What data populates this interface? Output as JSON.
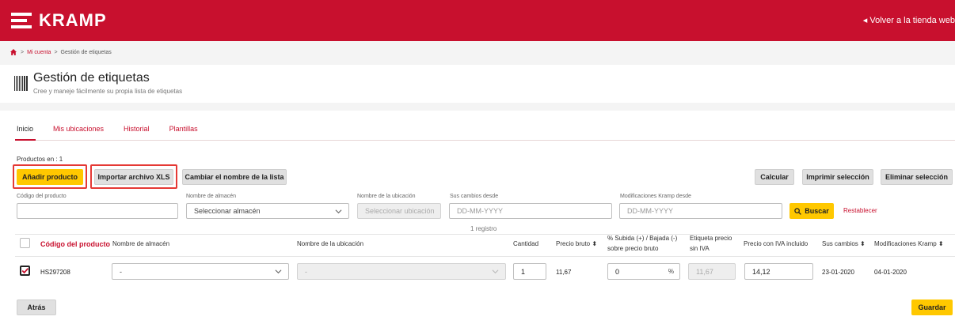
{
  "header": {
    "brand": "KRAMP",
    "back_link": "◂ Volver a la tienda web",
    "brand_color": "#c8102e"
  },
  "breadcrumb": [
    "Mi cuenta",
    "Gestión de etiquetas"
  ],
  "breadcrumb_sep": ">",
  "page": {
    "title": "Gestión de etiquetas",
    "subtitle": "Cree y maneje fácilmente su propia lista de etiquetas"
  },
  "tabs": [
    {
      "label": "Inicio",
      "active": true
    },
    {
      "label": "Mis ubicaciones",
      "active": false
    },
    {
      "label": "Historial",
      "active": false
    },
    {
      "label": "Plantillas",
      "active": false
    }
  ],
  "products_in": "Productos en : 1",
  "toolbar": {
    "add_product": "Añadir producto",
    "import_xls": "Importar archivo XLS",
    "rename_list": "Cambiar el nombre de la lista",
    "calculate": "Calcular",
    "print_selection": "Imprimir selección",
    "delete_selection": "Eliminar selección"
  },
  "filters": {
    "product_code_label": "Código del producto",
    "product_code_value": "",
    "warehouse_label": "Nombre de almacén",
    "warehouse_placeholder": "Seleccionar almacén",
    "location_label": "Nombre de la ubicación",
    "location_placeholder": "Seleccionar ubicación",
    "changes_since_label": "Sus cambios desde",
    "changes_since_placeholder": "DD-MM-YYYY",
    "kramp_changes_label": "Modificaciones Kramp desde",
    "kramp_changes_placeholder": "DD-MM-YYYY",
    "search": "Buscar",
    "reset": "Restablecer"
  },
  "result_count": "1 registro",
  "table": {
    "columns": {
      "product_code": "Código del producto",
      "warehouse": "Nombre de almacén",
      "location": "Nombre de la ubicación",
      "quantity": "Cantidad",
      "gross_price": "Precio bruto ⬍",
      "markup_1": "% Subida (+) / Bajada (-)",
      "markup_2": "sobre precio bruto",
      "label_price_1": "Etiqueta precio",
      "label_price_2": "sin IVA",
      "price_vat": "Precio con IVA incluido",
      "your_changes": "Sus cambios ⬍",
      "kramp_changes": "Modificaciones Kramp ⬍"
    },
    "rows": [
      {
        "checked": true,
        "product_code": "HS297208",
        "warehouse": "-",
        "location": "-",
        "quantity": "1",
        "gross_price": "11,67",
        "markup": "0",
        "markup_unit": "%",
        "label_price": "11,67",
        "price_vat": "14,12",
        "your_changes": "23-01-2020",
        "kramp_changes": "04-01-2020"
      }
    ]
  },
  "footer": {
    "back": "Atrás",
    "save": "Guardar"
  },
  "colors": {
    "accent_yellow": "#ffc800",
    "highlight_red": "#e53935"
  }
}
